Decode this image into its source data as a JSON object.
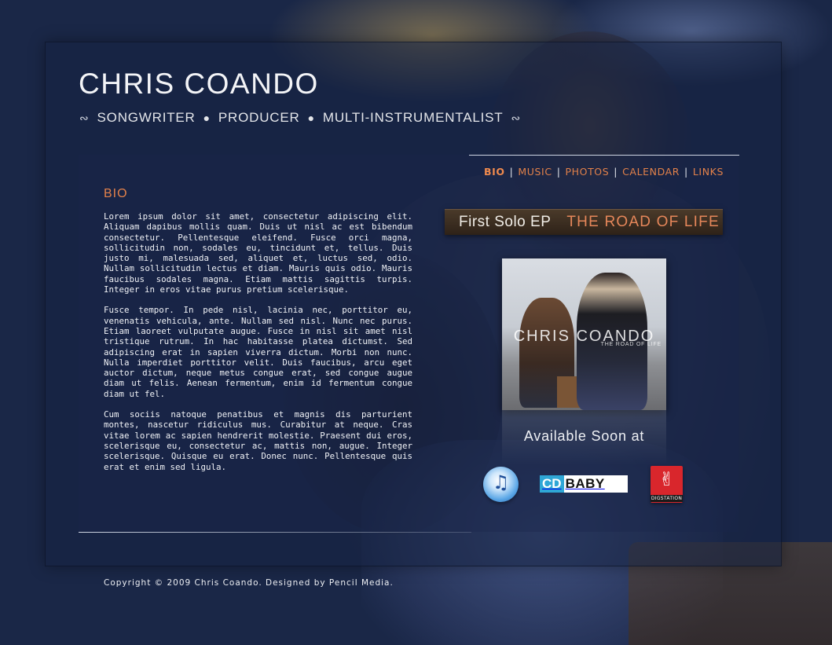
{
  "site": {
    "title": "CHRIS COANDO",
    "tagline": [
      "SONGWRITER",
      "PRODUCER",
      "MULTI-INSTRUMENTALIST"
    ]
  },
  "nav": {
    "items": [
      "BIO",
      "MUSIC",
      "PHOTOS",
      "CALENDAR",
      "LINKS"
    ],
    "active": "BIO",
    "separator": "|"
  },
  "bio": {
    "heading": "BIO",
    "paragraphs": [
      "Lorem ipsum dolor sit amet, consectetur adipiscing elit. Aliquam dapibus mollis quam. Duis ut nisl ac est bibendum consectetur. Pellentesque eleifend. Fusce orci magna, sollicitudin non, sodales eu, tincidunt et, tellus. Duis justo mi, malesuada sed, aliquet et, luctus sed, odio. Nullam sollicitudin lectus et diam. Mauris quis odio. Mauris faucibus sodales magna. Etiam mattis sagittis turpis. Integer in eros vitae purus pretium scelerisque.",
      "Fusce tempor. In pede nisl, lacinia nec, porttitor eu, venenatis vehicula, ante. Nullam sed nisl. Nunc nec purus. Etiam laoreet vulputate augue. Fusce in nisl sit amet nisl tristique rutrum. In hac habitasse platea dictumst. Sed adipiscing erat in sapien viverra dictum. Morbi non nunc. Nulla imperdiet porttitor velit. Duis faucibus, arcu eget auctor dictum, neque metus congue erat, sed congue augue diam ut felis. Aenean fermentum, enim id fermentum congue diam ut fel.",
      "Cum sociis natoque penatibus et magnis dis parturient montes, nascetur ridiculus mus. Curabitur at neque. Cras vitae lorem ac sapien hendrerit molestie. Praesent dui eros, scelerisque eu, consectetur ac, mattis non, augue. Integer scelerisque. Quisque eu erat. Donec nunc. Pellentesque quis erat et enim sed ligula."
    ]
  },
  "ep": {
    "label": "First Solo EP",
    "title": "THE ROAD OF LIFE",
    "album_artist": "CHRIS COANDO",
    "album_subtitle": "THE ROAD OF LIFE",
    "available_text": "Available Soon at"
  },
  "stores": {
    "itunes_icon": "itunes-icon",
    "cdbaby_cd": "CD",
    "cdbaby_baby": "BABY",
    "digstation_label": "DIGSTATION"
  },
  "footer": {
    "text": "Copyright © 2009 Chris Coando. Designed by Pencil Media."
  },
  "colors": {
    "background": "#1a2747",
    "accent": "#e2814a",
    "text": "#f0f2f6"
  }
}
